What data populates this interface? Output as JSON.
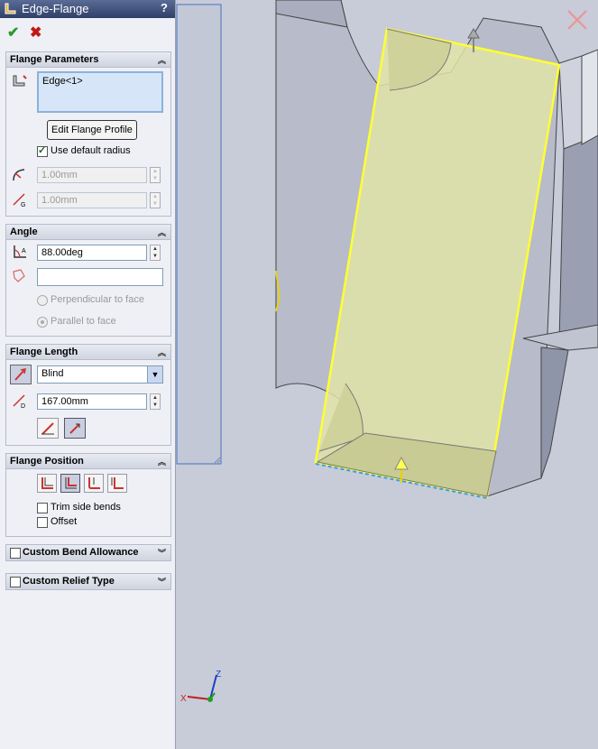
{
  "panel": {
    "title": "Edge-Flange",
    "help": "?",
    "ok": "✔",
    "cancel": "✖"
  },
  "flange_parameters": {
    "header": "Flange Parameters",
    "edge_list": "Edge<1>",
    "edit_profile_label": "Edit Flange Profile",
    "use_default_radius_label": "Use default radius",
    "use_default_radius_checked": true,
    "radius_value": "1.00mm",
    "gap_value": "1.00mm"
  },
  "angle": {
    "header": "Angle",
    "angle_value": "88.00deg",
    "reference_face_value": "",
    "perpendicular_label": "Perpendicular to face",
    "parallel_label": "Parallel to face"
  },
  "flange_length": {
    "header": "Flange Length",
    "end_condition": "Blind",
    "length_value": "167.00mm"
  },
  "flange_position": {
    "header": "Flange Position",
    "trim_side_bends_label": "Trim side bends",
    "offset_label": "Offset"
  },
  "custom_bend_allowance": {
    "header": "Custom Bend Allowance"
  },
  "custom_relief_type": {
    "header": "Custom Relief Type"
  },
  "triad": {
    "x": "X",
    "z": "Z"
  },
  "colors": {
    "title_bar": "#3a4a74",
    "preview_fill": "#e1e4a8",
    "preview_outline": "#ffff33",
    "part_face": "#b9bdcc",
    "background": "#c8ccd9"
  }
}
